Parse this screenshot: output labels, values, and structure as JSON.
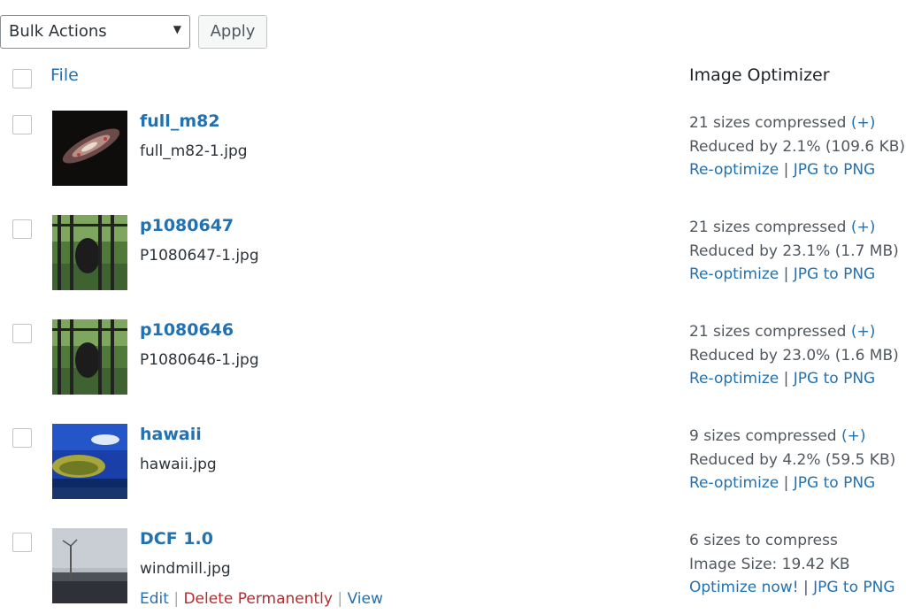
{
  "bulk": {
    "select_value": "Bulk Actions",
    "apply_label": "Apply"
  },
  "columns": {
    "file": "File",
    "optimizer": "Image Optimizer"
  },
  "rows": [
    {
      "title": "full_m82",
      "filename": "full_m82-1.jpg",
      "status": "21 sizes compressed",
      "more": "(+)",
      "detail": "Reduced by 2.1% (109.6 KB)",
      "action1": "Re-optimize",
      "action2": "JPG to PNG"
    },
    {
      "title": "p1080647",
      "filename": "P1080647-1.jpg",
      "status": "21 sizes compressed",
      "more": "(+)",
      "detail": "Reduced by 23.1% (1.7 MB)",
      "action1": "Re-optimize",
      "action2": "JPG to PNG"
    },
    {
      "title": "p1080646",
      "filename": "P1080646-1.jpg",
      "status": "21 sizes compressed",
      "more": "(+)",
      "detail": "Reduced by 23.0% (1.6 MB)",
      "action1": "Re-optimize",
      "action2": "JPG to PNG"
    },
    {
      "title": "hawaii",
      "filename": "hawaii.jpg",
      "status": "9 sizes compressed",
      "more": "(+)",
      "detail": "Reduced by 4.2% (59.5 KB)",
      "action1": "Re-optimize",
      "action2": "JPG to PNG"
    },
    {
      "title": "DCF 1.0",
      "filename": "windmill.jpg",
      "status": "6 sizes to compress",
      "detail": "Image Size: 19.42 KB",
      "action1": "Optimize now!",
      "action2": "JPG to PNG",
      "row_actions": {
        "edit": "Edit",
        "delete": "Delete Permanently",
        "view": "View"
      }
    }
  ],
  "separator": "|"
}
